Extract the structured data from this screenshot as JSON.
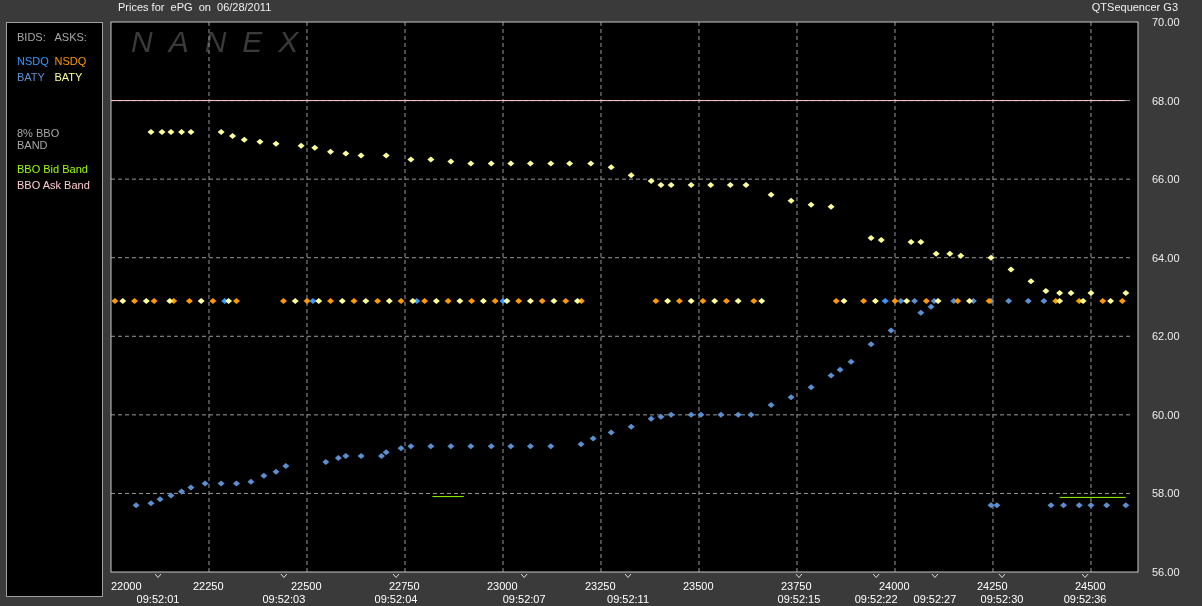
{
  "header": {
    "title": "Prices for  ePG  on  06/28/2011",
    "app_name": "QTSequencer G3"
  },
  "legend": {
    "bids_header": "BIDS:",
    "asks_header": "ASKS:",
    "band_title": "8% BBO BAND"
  },
  "chart": {
    "watermark": "NANEX",
    "chart_data": {
      "type": "scatter",
      "xlim": [
        22000,
        24620
      ],
      "ylim": [
        56,
        70
      ],
      "xticks": [
        22000,
        22250,
        22500,
        22750,
        23000,
        23250,
        23500,
        23750,
        24000,
        24250,
        24500
      ],
      "yticks": [
        {
          "value": 56,
          "label": "56.00"
        },
        {
          "value": 58,
          "label": "58.00"
        },
        {
          "value": 60,
          "label": "60.00"
        },
        {
          "value": 62,
          "label": "62.00"
        },
        {
          "value": 64,
          "label": "64.00"
        },
        {
          "value": 66,
          "label": "66.00"
        },
        {
          "value": 68,
          "label": "68.00"
        },
        {
          "value": 70,
          "label": "70.00"
        }
      ],
      "series": [
        {
          "name": "NSDQ",
          "color": "#3399ff",
          "x": [
            22290,
            22515,
            22780,
            23000,
            23975
          ],
          "values": [
            62.9,
            62.9,
            62.9,
            62.9,
            62.9
          ]
        },
        {
          "name": "BATY",
          "color": "#5b8fd0",
          "x": [
            22064,
            22102,
            22125,
            22153,
            22180,
            22204,
            22240,
            22281,
            22320,
            22357,
            22390,
            22421,
            22446,
            22548,
            22580,
            22599,
            22638,
            22690,
            22702,
            22740,
            22765,
            22816,
            22867,
            22918,
            22970,
            23020,
            23070,
            23122,
            23199,
            23230,
            23276,
            23327,
            23378,
            23403,
            23429,
            23480,
            23505,
            23556,
            23600,
            23633,
            23684,
            23735,
            23786,
            23837,
            23860,
            23888,
            23939,
            23990,
            24066,
            24092,
            24015,
            24050,
            24100,
            24150,
            24200,
            24245,
            24290,
            24340,
            24380,
            24245,
            24260,
            24398,
            24430,
            24470,
            24500,
            24540,
            24589
          ],
          "values": [
            57.7,
            57.75,
            57.85,
            57.95,
            58.05,
            58.15,
            58.25,
            58.25,
            58.25,
            58.3,
            58.45,
            58.55,
            58.7,
            58.8,
            58.9,
            58.95,
            58.95,
            58.95,
            59.05,
            59.15,
            59.2,
            59.2,
            59.2,
            59.2,
            59.2,
            59.2,
            59.2,
            59.2,
            59.25,
            59.4,
            59.55,
            59.7,
            59.9,
            59.95,
            60.0,
            60.0,
            60.0,
            60.0,
            60.0,
            60.0,
            60.25,
            60.45,
            60.7,
            61.0,
            61.15,
            61.35,
            61.8,
            62.15,
            62.6,
            62.75,
            62.9,
            62.9,
            62.9,
            62.9,
            62.9,
            62.9,
            62.9,
            62.9,
            62.9,
            57.7,
            57.7,
            57.7,
            57.7,
            57.7,
            57.7,
            57.7,
            57.7
          ]
        },
        {
          "name": "NSDQ",
          "color": "#ff9900",
          "x": [
            22010,
            22060,
            22110,
            22160,
            22200,
            22260,
            22320,
            22440,
            22500,
            22560,
            22620,
            22680,
            22740,
            22800,
            22860,
            22920,
            22980,
            23040,
            23100,
            23160,
            23200,
            23390,
            23450,
            23510,
            23570,
            23640,
            23850,
            23920,
            24000,
            24080,
            24160,
            24240,
            24410,
            24470,
            24530,
            24580
          ],
          "values": [
            62.9,
            62.9,
            62.9,
            62.9,
            62.9,
            62.9,
            62.9,
            62.9,
            62.9,
            62.9,
            62.9,
            62.9,
            62.9,
            62.9,
            62.9,
            62.9,
            62.9,
            62.9,
            62.9,
            62.9,
            62.9,
            62.9,
            62.9,
            62.9,
            62.9,
            62.9,
            62.9,
            62.9,
            62.9,
            62.9,
            62.9,
            62.9,
            62.9,
            62.9,
            62.9,
            62.9
          ]
        },
        {
          "name": "BATY",
          "color": "#ffff99",
          "x": [
            22102,
            22130,
            22153,
            22180,
            22204,
            22281,
            22310,
            22340,
            22380,
            22421,
            22485,
            22520,
            22560,
            22599,
            22638,
            22702,
            22765,
            22816,
            22867,
            22918,
            22970,
            23020,
            23070,
            23122,
            23170,
            23224,
            23276,
            23327,
            23378,
            23403,
            23429,
            23480,
            23530,
            23580,
            23620,
            23684,
            23735,
            23786,
            23837,
            23939,
            23965,
            24041,
            24066,
            24105,
            24140,
            24168,
            24245,
            24296,
            24347,
            24385,
            24420,
            24449,
            24500,
            24589,
            22030,
            22090,
            22150,
            22230,
            22300,
            22470,
            22530,
            22590,
            22650,
            22710,
            22770,
            22830,
            22890,
            22950,
            23010,
            23070,
            23130,
            23190,
            23420,
            23480,
            23540,
            23600,
            23660,
            23870,
            23950,
            24030,
            24110,
            24190,
            24420,
            24480,
            24550
          ],
          "values": [
            67.2,
            67.2,
            67.2,
            67.2,
            67.2,
            67.2,
            67.1,
            67.0,
            66.95,
            66.9,
            66.85,
            66.8,
            66.7,
            66.65,
            66.6,
            66.6,
            66.5,
            66.5,
            66.45,
            66.4,
            66.4,
            66.4,
            66.4,
            66.4,
            66.4,
            66.4,
            66.3,
            66.1,
            65.95,
            65.85,
            65.85,
            65.85,
            65.85,
            65.85,
            65.85,
            65.6,
            65.45,
            65.35,
            65.3,
            64.5,
            64.45,
            64.4,
            64.4,
            64.1,
            64.1,
            64.05,
            64.0,
            63.7,
            63.4,
            63.15,
            63.1,
            63.1,
            63.1,
            63.1,
            62.9,
            62.9,
            62.9,
            62.9,
            62.9,
            62.9,
            62.9,
            62.9,
            62.9,
            62.9,
            62.9,
            62.9,
            62.9,
            62.9,
            62.9,
            62.9,
            62.9,
            62.9,
            62.9,
            62.9,
            62.9,
            62.9,
            62.9,
            62.9,
            62.9,
            62.9,
            62.9,
            62.9,
            62.9,
            62.9,
            62.9
          ]
        },
        {
          "name": "BBO Bid Band",
          "color": "#99ff00",
          "type": "line",
          "x": [
            22820,
            22900,
            null,
            24420,
            24589
          ],
          "values": [
            57.92,
            57.92,
            null,
            57.9,
            57.9
          ]
        },
        {
          "name": "BBO Ask Band",
          "color": "#ffcccc",
          "type": "line",
          "x": [
            22000,
            24589
          ],
          "values": [
            68.0,
            68.0
          ]
        }
      ],
      "grid": true,
      "annotations": [
        "09:52:01",
        "09:52:03",
        "09:52:04",
        "09:52:07",
        "09:52:11",
        "09:52:15",
        "09:52:22",
        "09:52:27",
        "09:52:30",
        "09:52:36"
      ]
    }
  }
}
